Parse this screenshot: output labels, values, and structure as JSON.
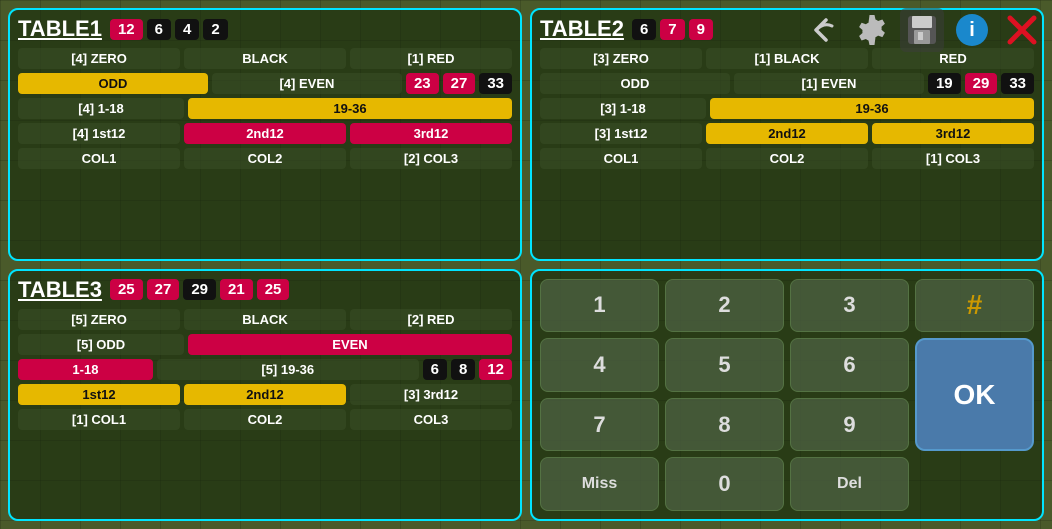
{
  "toolbar": {
    "back_label": "↺",
    "settings_label": "🔧",
    "save_label": "💾",
    "info_label": "ℹ",
    "close_label": "✕"
  },
  "table1": {
    "title": "TABLE1",
    "header_numbers": [
      {
        "value": "12",
        "color": "badge-red"
      },
      {
        "value": "6",
        "color": "badge-black"
      },
      {
        "value": "4",
        "color": "badge-black"
      },
      {
        "value": "2",
        "color": "badge-black"
      }
    ],
    "rows": [
      [
        {
          "label": "[4] ZERO",
          "style": "cell-dark"
        },
        {
          "label": "BLACK",
          "style": "cell-dark"
        },
        {
          "label": "[1] RED",
          "style": "cell-dark"
        }
      ],
      [
        {
          "label": "ODD",
          "style": "cell-yellow"
        },
        {
          "label": "[4] EVEN",
          "style": "cell-dark"
        },
        {
          "label": "",
          "style": ""
        },
        {
          "label": "23",
          "style": "badge-red num-badge"
        },
        {
          "label": "27",
          "style": "badge-red num-badge"
        },
        {
          "label": "33",
          "style": "badge-black num-badge"
        }
      ],
      [
        {
          "label": "[4] 1-18",
          "style": "cell-dark"
        },
        {
          "label": "19-36",
          "style": "cell-yellow"
        },
        {
          "label": "",
          "style": ""
        }
      ],
      [
        {
          "label": "[4] 1st12",
          "style": "cell-dark"
        },
        {
          "label": "2nd12",
          "style": "cell-crimson"
        },
        {
          "label": "3rd12",
          "style": "cell-crimson"
        }
      ],
      [
        {
          "label": "COL1",
          "style": "cell-dark"
        },
        {
          "label": "COL2",
          "style": "cell-dark"
        },
        {
          "label": "[2] COL3",
          "style": "cell-dark"
        }
      ]
    ]
  },
  "table2": {
    "title": "TABLE2",
    "header_numbers": [
      {
        "value": "6",
        "color": "badge-black"
      },
      {
        "value": "7",
        "color": "badge-red"
      },
      {
        "value": "9",
        "color": "badge-red"
      }
    ],
    "rows": [
      [
        {
          "label": "[3] ZERO",
          "style": "cell-dark"
        },
        {
          "label": "[1] BLACK",
          "style": "cell-dark"
        },
        {
          "label": "RED",
          "style": "cell-dark"
        }
      ],
      [
        {
          "label": "ODD",
          "style": "cell-dark"
        },
        {
          "label": "[1] EVEN",
          "style": "cell-dark"
        },
        {
          "label": ""
        },
        {
          "label": "19",
          "style": "badge-black"
        },
        {
          "label": "29",
          "style": "badge-red"
        },
        {
          "label": "33",
          "style": "badge-black"
        }
      ],
      [
        {
          "label": "[3] 1-18",
          "style": "cell-dark"
        },
        {
          "label": "19-36",
          "style": "cell-yellow"
        },
        {
          "label": ""
        }
      ],
      [
        {
          "label": "[3] 1st12",
          "style": "cell-dark"
        },
        {
          "label": "2nd12",
          "style": "cell-yellow"
        },
        {
          "label": "3rd12",
          "style": "cell-yellow"
        }
      ],
      [
        {
          "label": "COL1",
          "style": "cell-dark"
        },
        {
          "label": "COL2",
          "style": "cell-dark"
        },
        {
          "label": "[1] COL3",
          "style": "cell-dark"
        }
      ]
    ]
  },
  "table3": {
    "title": "TABLE3",
    "header_numbers": [
      {
        "value": "25",
        "color": "badge-red"
      },
      {
        "value": "27",
        "color": "badge-red"
      },
      {
        "value": "29",
        "color": "badge-black"
      },
      {
        "value": "21",
        "color": "badge-red"
      },
      {
        "value": "25",
        "color": "badge-red"
      }
    ],
    "rows": [
      [
        {
          "label": "[5] ZERO",
          "style": "cell-dark"
        },
        {
          "label": "BLACK",
          "style": "cell-dark"
        },
        {
          "label": "[2] RED",
          "style": "cell-dark"
        }
      ],
      [
        {
          "label": "[5] ODD",
          "style": "cell-dark"
        },
        {
          "label": "EVEN",
          "style": "cell-crimson"
        },
        {
          "label": ""
        }
      ],
      [
        {
          "label": "1-18",
          "style": "cell-crimson"
        },
        {
          "label": "[5] 19-36",
          "style": "cell-dark"
        },
        {
          "label": ""
        },
        {
          "label": "6",
          "style": "badge-black"
        },
        {
          "label": "8",
          "style": "badge-black"
        },
        {
          "label": "12",
          "style": "badge-red"
        }
      ],
      [
        {
          "label": "1st12",
          "style": "cell-yellow"
        },
        {
          "label": "2nd12",
          "style": "cell-yellow"
        },
        {
          "label": "[3] 3rd12",
          "style": "cell-dark"
        }
      ],
      [
        {
          "label": "[1] COL1",
          "style": "cell-dark"
        },
        {
          "label": "COL2",
          "style": "cell-dark"
        },
        {
          "label": "COL3",
          "style": "cell-dark"
        }
      ]
    ]
  },
  "numpad": {
    "keys": [
      "1",
      "2",
      "3",
      "4",
      "5",
      "6",
      "7",
      "8",
      "9",
      "Miss",
      "0",
      "Del"
    ],
    "ok": "OK",
    "hash": "#"
  }
}
